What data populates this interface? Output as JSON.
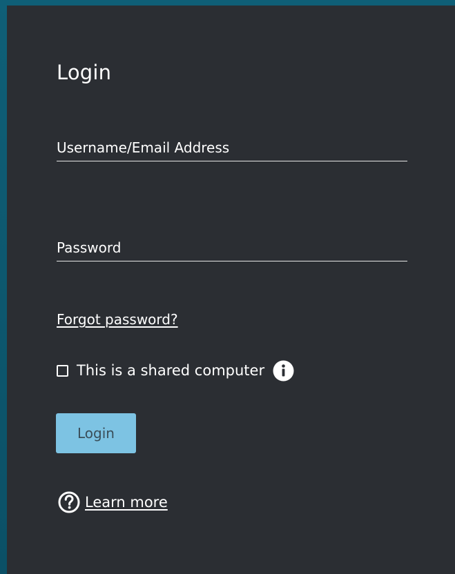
{
  "login_form": {
    "title": "Login",
    "username_placeholder": "Username/Email Address",
    "password_placeholder": "Password",
    "forgot_password_label": "Forgot password?",
    "shared_computer_label": "This is a shared computer",
    "shared_computer_checked": false,
    "submit_label": "Login",
    "learn_more_label": "Learn more"
  },
  "icons": {
    "info": "info-circle-icon",
    "help": "question-circle-icon"
  },
  "colors": {
    "panel_background": "#2b2e33",
    "frame_background": "#0f5f77",
    "button_background": "#7dc3e3",
    "button_text": "#3a4e59",
    "text": "#ffffff"
  }
}
